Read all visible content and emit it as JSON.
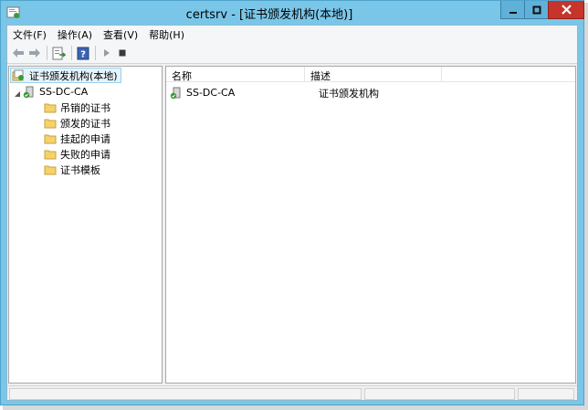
{
  "window": {
    "title": "certsrv - [证书颁发机构(本地)]",
    "colors": {
      "frame": "#7ac6e8",
      "close_button": "#c7342b"
    }
  },
  "window_controls": {
    "minimize": "minimize-icon",
    "maximize": "maximize-icon",
    "close": "close-icon"
  },
  "menu": {
    "items": [
      {
        "label": "文件(F)"
      },
      {
        "label": "操作(A)"
      },
      {
        "label": "查看(V)"
      },
      {
        "label": "帮助(H)"
      }
    ]
  },
  "toolbar": {
    "buttons": [
      "back-arrow-icon",
      "forward-arrow-icon",
      "export-list-icon",
      "help-icon",
      "start-service-icon",
      "stop-service-icon"
    ]
  },
  "tree": {
    "root": "证书颁发机构(本地)",
    "ca": "SS-DC-CA",
    "folders": [
      "吊销的证书",
      "颁发的证书",
      "挂起的申请",
      "失败的申请",
      "证书模板"
    ]
  },
  "list": {
    "columns": {
      "name": "名称",
      "description": "描述"
    },
    "rows": [
      {
        "name": "SS-DC-CA",
        "description": "证书颁发机构"
      }
    ]
  },
  "statusbar": {
    "text": ""
  }
}
